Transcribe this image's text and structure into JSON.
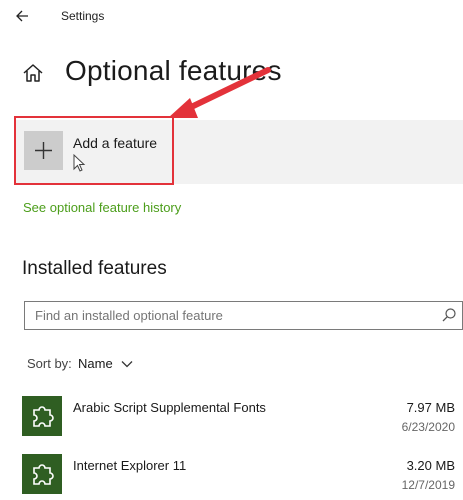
{
  "window": {
    "title": "Settings"
  },
  "page": {
    "title": "Optional features"
  },
  "add_feature": {
    "label": "Add a feature"
  },
  "history_link": {
    "label": "See optional feature history"
  },
  "installed": {
    "title": "Installed features",
    "search_placeholder": "Find an installed optional feature",
    "sort_label": "Sort by:",
    "sort_value": "Name",
    "items": [
      {
        "name": "Arabic Script Supplemental Fonts",
        "size": "7.97 MB",
        "date": "6/23/2020"
      },
      {
        "name": "Internet Explorer 11",
        "size": "3.20 MB",
        "date": "12/7/2019"
      }
    ]
  },
  "colors": {
    "accent_link": "#4c9e1b",
    "feature_icon_bg": "#2f5e22",
    "annotation_red": "#e3323a"
  },
  "icons": [
    "back-arrow-icon",
    "home-icon",
    "plus-icon",
    "search-icon",
    "chevron-down-icon",
    "puzzle-piece-icon"
  ]
}
